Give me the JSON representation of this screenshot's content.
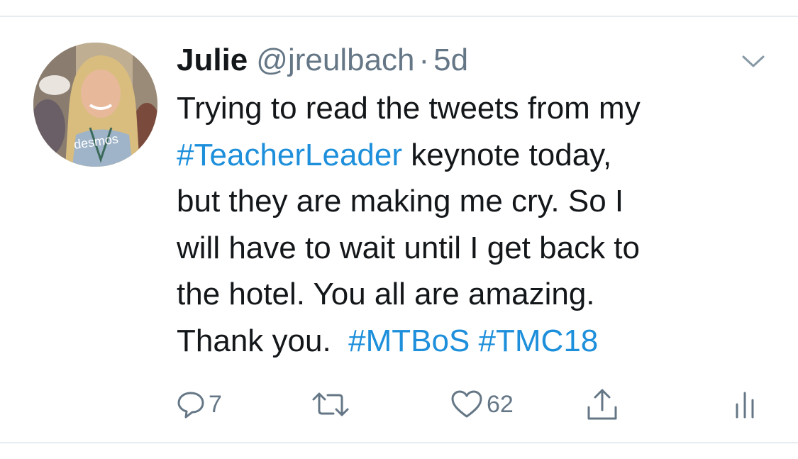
{
  "tweet": {
    "display_name": "Julie",
    "handle": "@jreulbach",
    "separator": "·",
    "time": "5d",
    "body_lines": [
      [
        {
          "text": "Trying to read the tweets from my",
          "hashtag": false
        }
      ],
      [
        {
          "text": "#TeacherLeader",
          "hashtag": true
        },
        {
          "text": " keynote today,",
          "hashtag": false
        }
      ],
      [
        {
          "text": "but they are making me cry. So I",
          "hashtag": false
        }
      ],
      [
        {
          "text": "will have to wait until I get back to",
          "hashtag": false
        }
      ],
      [
        {
          "text": "the hotel. You all are amazing.",
          "hashtag": false
        }
      ],
      [
        {
          "text": "Thank you.  ",
          "hashtag": false
        },
        {
          "text": "#MTBoS",
          "hashtag": true
        },
        {
          "text": " ",
          "hashtag": false
        },
        {
          "text": "#TMC18",
          "hashtag": true
        }
      ]
    ],
    "actions": {
      "reply_count": "7",
      "retweet_count": "",
      "like_count": "62"
    }
  },
  "icons": {
    "reply": "reply-icon",
    "retweet": "retweet-icon",
    "like": "heart-icon",
    "share": "share-icon",
    "analytics": "analytics-icon",
    "menu": "chevron-down-icon"
  },
  "colors": {
    "text": "#14171a",
    "secondary": "#657786",
    "hashtag": "#1d8fdb",
    "divider": "#e6ecf0"
  }
}
